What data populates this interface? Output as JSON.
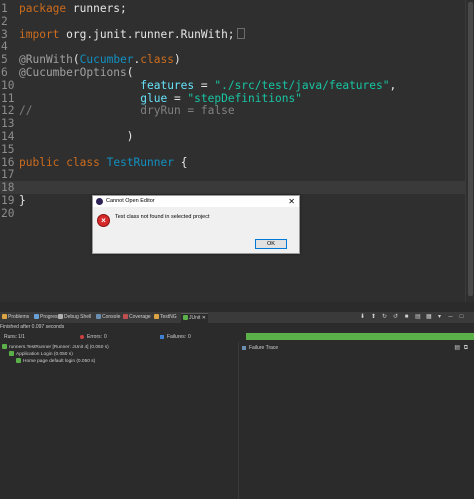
{
  "editor": {
    "lines": [
      {
        "n": "1",
        "segs": [
          [
            "kw",
            "package"
          ],
          [
            "plain",
            " runners;"
          ]
        ]
      },
      {
        "n": "2",
        "segs": []
      },
      {
        "n": "3",
        "fold": true,
        "segs": [
          [
            "kw",
            "import"
          ],
          [
            "plain",
            " org.junit.runner.RunWith;"
          ]
        ]
      },
      {
        "n": "4",
        "segs": []
      },
      {
        "n": "5",
        "segs": [
          [
            "ann",
            "@RunWith"
          ],
          [
            "plain",
            "("
          ],
          [
            "cls",
            "Cucumber"
          ],
          [
            "plain",
            "."
          ],
          [
            "kw",
            "class"
          ],
          [
            "plain",
            ")"
          ]
        ]
      },
      {
        "n": "6",
        "segs": [
          [
            "ann",
            "@CucumberOptions"
          ],
          [
            "plain",
            "("
          ]
        ]
      },
      {
        "n": "10",
        "segs": [
          [
            "plain",
            "                  "
          ],
          [
            "fld",
            "features"
          ],
          [
            "plain",
            " = "
          ],
          [
            "str",
            "\"./src/test/java/features\""
          ],
          [
            "plain",
            ","
          ]
        ]
      },
      {
        "n": "11",
        "segs": [
          [
            "plain",
            "                  "
          ],
          [
            "fld",
            "glue"
          ],
          [
            "plain",
            " = "
          ],
          [
            "str",
            "\"stepDefinitions\""
          ]
        ]
      },
      {
        "n": "12",
        "segs": [
          [
            "cmt",
            "//"
          ],
          [
            "plain",
            "                "
          ],
          [
            "cmt",
            "dryRun = false"
          ]
        ]
      },
      {
        "n": "13",
        "segs": []
      },
      {
        "n": "14",
        "segs": [
          [
            "plain",
            "                )"
          ]
        ]
      },
      {
        "n": "15",
        "segs": []
      },
      {
        "n": "16",
        "segs": [
          [
            "kw",
            "public"
          ],
          [
            "plain",
            " "
          ],
          [
            "kw",
            "class"
          ],
          [
            "plain",
            " "
          ],
          [
            "cls",
            "TestRunner"
          ],
          [
            "plain",
            " {"
          ]
        ]
      },
      {
        "n": "17",
        "segs": []
      },
      {
        "n": "18",
        "current": true,
        "segs": []
      },
      {
        "n": "19",
        "segs": [
          [
            "plain",
            "}"
          ]
        ]
      },
      {
        "n": "20",
        "segs": []
      }
    ]
  },
  "dialog": {
    "title": "Cannot Open Editor",
    "close": "✕",
    "message": "Test class not found in selected project",
    "ok_label": "OK"
  },
  "views": {
    "tabs": [
      "Problems",
      "Progress",
      "Debug Shell",
      "Console",
      "Coverage",
      "TestNG",
      "JUnit"
    ],
    "active_tab": "JUnit",
    "tab_close": "✕",
    "icon_colors": [
      "#d9a441",
      "#6aa0d8",
      "#b0b0b0",
      "#6a8fb0",
      "#c05050",
      "#d9a441",
      "#5bb04a"
    ]
  },
  "junit": {
    "status": "Finished after 0.097 seconds",
    "runs_label": "Runs:",
    "runs_value": "1/1",
    "errors_label": "Errors:",
    "errors_value": "0",
    "failures_label": "Failures:",
    "failures_value": "0",
    "progress_color": "#5bb04a",
    "failure_trace": "Failure Trace",
    "tree": [
      {
        "label": "runners.TestRunner [Runner: JUnit 4] (0.050 s)",
        "level": 0
      },
      {
        "label": "Application Login (0.050 s)",
        "level": 1
      },
      {
        "label": "Home page default login (0.050 s)",
        "level": 2
      }
    ]
  }
}
